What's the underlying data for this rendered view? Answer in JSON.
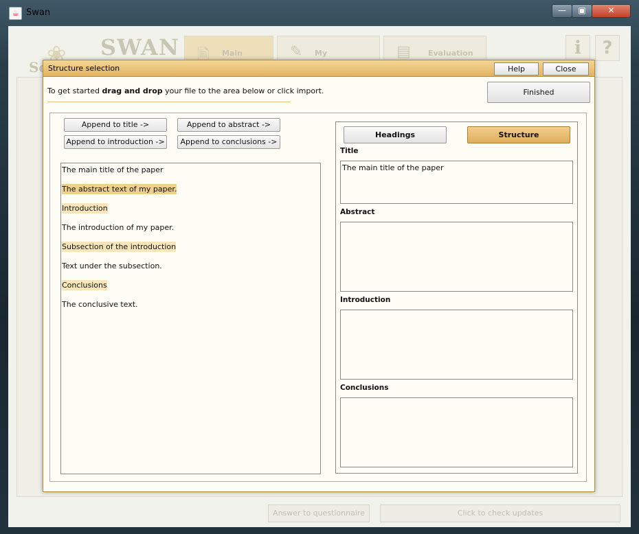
{
  "window": {
    "title": "Swan",
    "app_icon": "java-cup-icon",
    "controls": {
      "minimize": "—",
      "maximize": "▣",
      "close": "✕"
    }
  },
  "background_app": {
    "logo_text": "SWAN",
    "logo_prefix": "Sc",
    "tabs": [
      {
        "label": "Main",
        "icon": "document-icon"
      },
      {
        "label": "My",
        "icon": "pen-icon"
      },
      {
        "label": "Evaluation",
        "icon": "cards-icon"
      }
    ],
    "info_icon": "i",
    "help_icon": "?",
    "answer_button": "Answer to questionnaire",
    "updates_button": "Click to check updates"
  },
  "dialog": {
    "title": "Structure selection",
    "help_button": "Help",
    "close_button": "Close",
    "intro_before": "To get started ",
    "intro_bold": "drag and drop",
    "intro_after": " your file to the area below or click import.",
    "finished_button": "Finished",
    "append_buttons": {
      "title": "Append to title ->",
      "abstract": "Append to abstract ->",
      "introduction": "Append to introduction ->",
      "conclusions": "Append to conclusions ->"
    },
    "document_paragraphs": [
      {
        "text": "The main title of the paper",
        "highlight": "none"
      },
      {
        "text": "The abstract text of my paper.",
        "highlight": "selected"
      },
      {
        "text": "Introduction",
        "highlight": "heading"
      },
      {
        "text": "The introduction of my paper.",
        "highlight": "none"
      },
      {
        "text": "Subsection of the introduction",
        "highlight": "heading"
      },
      {
        "text": "Text under the subsection.",
        "highlight": "none"
      },
      {
        "text": "Conclusions",
        "highlight": "heading"
      },
      {
        "text": "The conclusive text.",
        "highlight": "none"
      }
    ],
    "view_toggle": {
      "headings": "Headings",
      "structure": "Structure",
      "active": "structure"
    },
    "sections": [
      {
        "label": "Title",
        "content": "The main title of the paper"
      },
      {
        "label": "Abstract",
        "content": ""
      },
      {
        "label": "Introduction",
        "content": ""
      },
      {
        "label": "Conclusions",
        "content": ""
      }
    ]
  },
  "colors": {
    "accent": "#e2b35f",
    "highlight": "#f7e6b9",
    "selected": "#efcf8c"
  }
}
